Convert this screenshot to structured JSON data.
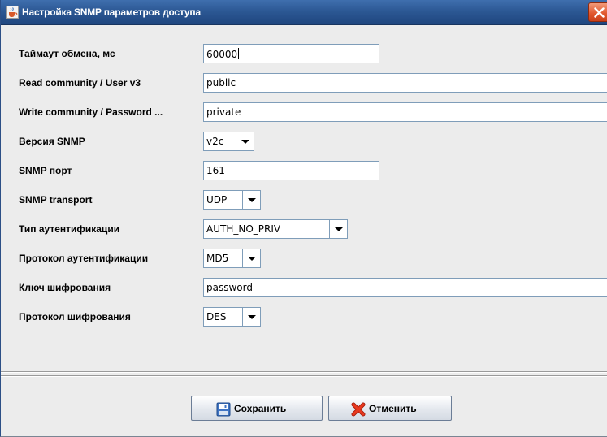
{
  "window": {
    "title": "Настройка SNMP параметров доступа",
    "icon": "java-cup-icon",
    "close_icon": "close-icon"
  },
  "form": {
    "timeout": {
      "label": "Таймаут обмена, мс",
      "value": "60000"
    },
    "read_community": {
      "label": "Read community / User v3",
      "value": "public"
    },
    "write_community": {
      "label": "Write community / Password ...",
      "value": "private"
    },
    "snmp_version": {
      "label": "Версия SNMP",
      "value": "v2c"
    },
    "snmp_port": {
      "label": "SNMP порт",
      "value": "161"
    },
    "snmp_transport": {
      "label": "SNMP transport",
      "value": "UDP"
    },
    "auth_type": {
      "label": "Тип аутентификации",
      "value": "AUTH_NO_PRIV"
    },
    "auth_protocol": {
      "label": "Протокол аутентификации",
      "value": "MD5"
    },
    "encryption_key": {
      "label": "Ключ шифрования",
      "value": "password"
    },
    "encryption_protocol": {
      "label": "Протокол шифрования",
      "value": "DES"
    }
  },
  "buttons": {
    "save": {
      "label": "Сохранить",
      "icon": "floppy-disk-icon"
    },
    "cancel": {
      "label": "Отменить",
      "icon": "red-x-icon"
    }
  },
  "colors": {
    "titlebar": "#2c5894",
    "close_button": "#e0562c",
    "field_border": "#7f9db9",
    "background": "#ececec"
  }
}
